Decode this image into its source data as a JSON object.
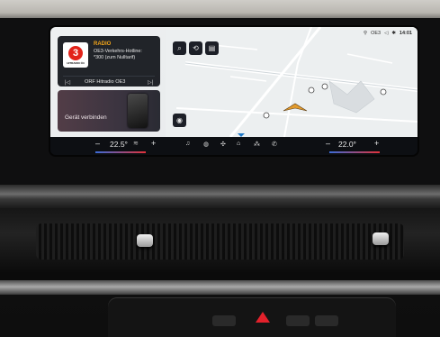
{
  "radio": {
    "source": "RADIO",
    "station_logo_mark": "3",
    "station_logo_sub": "HITRADIO Ö3",
    "info_line1": "OE3-Verkehrs-Hotline:",
    "info_line2": "*300 (zum Nulltarif)",
    "station": "ORF Hitradio OE3",
    "prev_icon": "skip-previous-icon",
    "next_icon": "skip-next-icon"
  },
  "phone": {
    "label": "Gerät verbinden"
  },
  "map_buttons": [
    "search-icon",
    "route-icon",
    "poi-icon"
  ],
  "status": {
    "signal": "OE3",
    "time": "14:01"
  },
  "climate": {
    "left_temp": "22.5°",
    "right_temp": "22.0°",
    "minus": "–",
    "plus": "+"
  },
  "bottom_icons": [
    "music-note-icon",
    "media-icon",
    "fan-icon",
    "home-icon",
    "apps-icon",
    "phone-icon"
  ],
  "colors": {
    "radio_accent": "#f2a51a",
    "nav_blue": "#1e79c8",
    "hazard_red": "#e3212b"
  }
}
